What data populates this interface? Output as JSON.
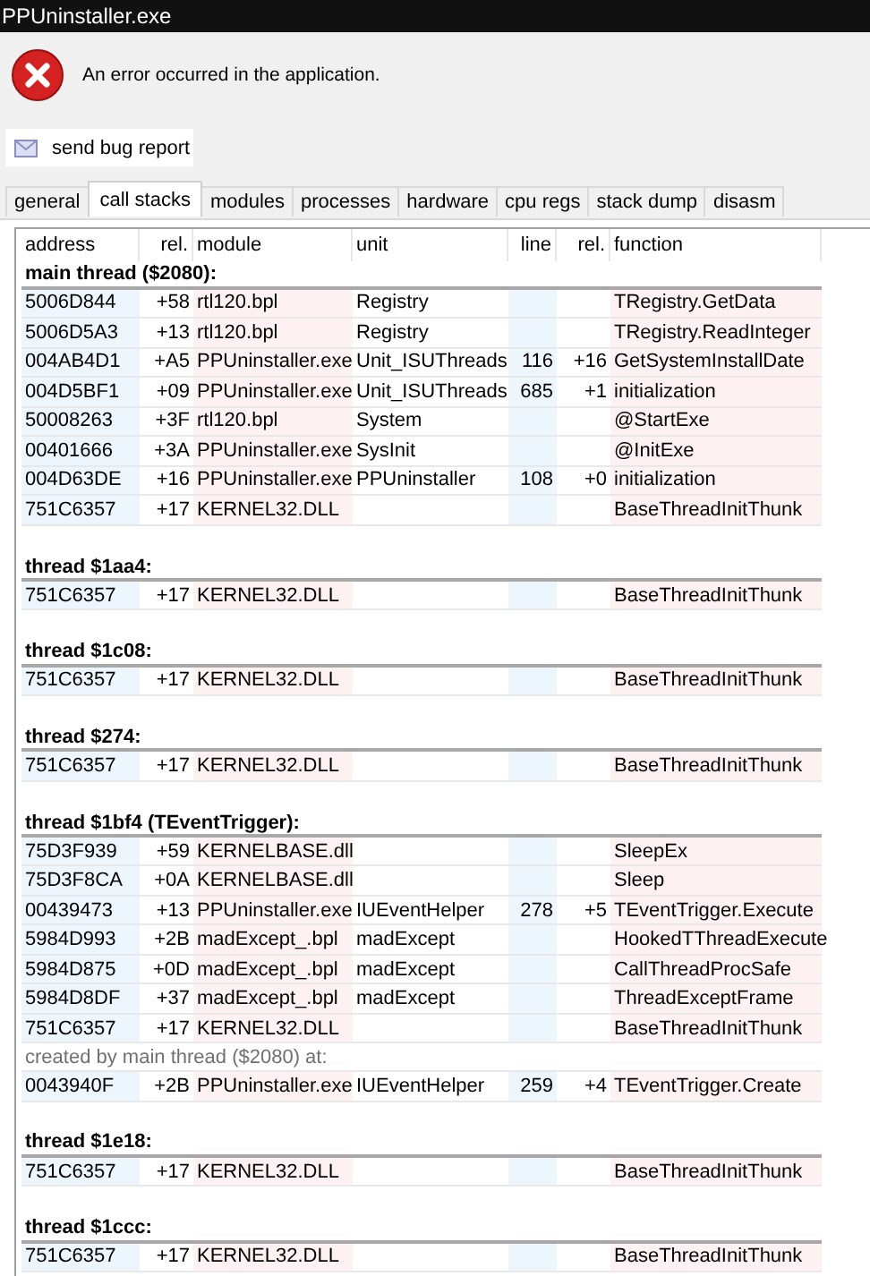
{
  "window": {
    "title": "PPUninstaller.exe"
  },
  "message": "An error occurred in the application.",
  "bug_report_button": "send bug report",
  "tabs": [
    {
      "label": "general",
      "selected": false
    },
    {
      "label": "call stacks",
      "selected": true
    },
    {
      "label": "modules",
      "selected": false
    },
    {
      "label": "processes",
      "selected": false
    },
    {
      "label": "hardware",
      "selected": false
    },
    {
      "label": "cpu regs",
      "selected": false
    },
    {
      "label": "stack dump",
      "selected": false
    },
    {
      "label": "disasm",
      "selected": false
    }
  ],
  "columns": [
    "address",
    "rel.",
    "module",
    "unit",
    "line",
    "rel.",
    "function"
  ],
  "threads": [
    {
      "title": "main thread ($2080):",
      "frames": [
        {
          "address": "5006D844",
          "rel": "+58",
          "module": "rtl120.bpl",
          "unit": "Registry",
          "function": "TRegistry.GetData"
        },
        {
          "address": "5006D5A3",
          "rel": "+13",
          "module": "rtl120.bpl",
          "unit": "Registry",
          "function": "TRegistry.ReadInteger"
        },
        {
          "address": "004AB4D1",
          "rel": "+A5",
          "module": "PPUninstaller.exe",
          "unit": "Unit_ISUThreads",
          "line": "116",
          "line_rel": "+16",
          "function": "GetSystemInstallDate"
        },
        {
          "address": "004D5BF1",
          "rel": "+09",
          "module": "PPUninstaller.exe",
          "unit": "Unit_ISUThreads",
          "line": "685",
          "line_rel": "+1",
          "function": "initialization"
        },
        {
          "address": "50008263",
          "rel": "+3F",
          "module": "rtl120.bpl",
          "unit": "System",
          "function": "@StartExe"
        },
        {
          "address": "00401666",
          "rel": "+3A",
          "module": "PPUninstaller.exe",
          "unit": "SysInit",
          "function": "@InitExe"
        },
        {
          "address": "004D63DE",
          "rel": "+16",
          "module": "PPUninstaller.exe",
          "unit": "PPUninstaller",
          "line": "108",
          "line_rel": "+0",
          "function": "initialization"
        },
        {
          "address": "751C6357",
          "rel": "+17",
          "module": "KERNEL32.DLL",
          "function": "BaseThreadInitThunk"
        }
      ]
    },
    {
      "title": "thread $1aa4:",
      "frames": [
        {
          "address": "751C6357",
          "rel": "+17",
          "module": "KERNEL32.DLL",
          "function": "BaseThreadInitThunk"
        }
      ]
    },
    {
      "title": "thread $1c08:",
      "frames": [
        {
          "address": "751C6357",
          "rel": "+17",
          "module": "KERNEL32.DLL",
          "function": "BaseThreadInitThunk"
        }
      ]
    },
    {
      "title": "thread $274:",
      "frames": [
        {
          "address": "751C6357",
          "rel": "+17",
          "module": "KERNEL32.DLL",
          "function": "BaseThreadInitThunk"
        }
      ]
    },
    {
      "title": "thread $1bf4 (TEventTrigger):",
      "frames": [
        {
          "address": "75D3F939",
          "rel": "+59",
          "module": "KERNELBASE.dll",
          "function": "SleepEx"
        },
        {
          "address": "75D3F8CA",
          "rel": "+0A",
          "module": "KERNELBASE.dll",
          "function": "Sleep"
        },
        {
          "address": "00439473",
          "rel": "+13",
          "module": "PPUninstaller.exe",
          "unit": "IUEventHelper",
          "line": "278",
          "line_rel": "+5",
          "function": "TEventTrigger.Execute"
        },
        {
          "address": "5984D993",
          "rel": "+2B",
          "module": "madExcept_.bpl",
          "unit": "madExcept",
          "function": "HookedTThreadExecute"
        },
        {
          "address": "5984D875",
          "rel": "+0D",
          "module": "madExcept_.bpl",
          "unit": "madExcept",
          "function": "CallThreadProcSafe"
        },
        {
          "address": "5984D8DF",
          "rel": "+37",
          "module": "madExcept_.bpl",
          "unit": "madExcept",
          "function": "ThreadExceptFrame"
        },
        {
          "address": "751C6357",
          "rel": "+17",
          "module": "KERNEL32.DLL",
          "function": "BaseThreadInitThunk"
        }
      ],
      "created_by": {
        "label": "created by main thread ($2080) at:",
        "frames": [
          {
            "address": "0043940F",
            "rel": "+2B",
            "module": "PPUninstaller.exe",
            "unit": "IUEventHelper",
            "line": "259",
            "line_rel": "+4",
            "function": "TEventTrigger.Create"
          }
        ]
      }
    },
    {
      "title": "thread $1e18:",
      "frames": [
        {
          "address": "751C6357",
          "rel": "+17",
          "module": "KERNEL32.DLL",
          "function": "BaseThreadInitThunk"
        }
      ]
    },
    {
      "title": "thread $1ccc:",
      "frames": [
        {
          "address": "751C6357",
          "rel": "+17",
          "module": "KERNEL32.DLL",
          "function": "BaseThreadInitThunk"
        }
      ]
    }
  ]
}
